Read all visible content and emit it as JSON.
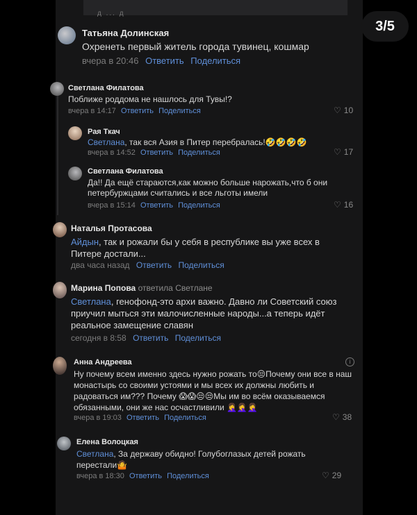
{
  "story": {
    "counter": "3/5",
    "top_strip_text": "д ... д"
  },
  "comments": {
    "c1": {
      "author": "Татьяна Долинская",
      "text": "Охренеть первый житель города тувинец, кошмар",
      "time": "вчера в 20:46",
      "reply": "Ответить",
      "share": "Поделиться"
    },
    "c2": {
      "author": "Светлана Филатова",
      "text": "Поближе роддома не нашлось для Тувы!?",
      "time": "вчера в 14:17",
      "reply": "Ответить",
      "share": "Поделиться",
      "likes": "10"
    },
    "c3": {
      "author": "Рая Ткач",
      "mention": "Светлана",
      "text": ", так вся Азия в Питер перебралась!🤣🤣🤣🤣",
      "time": "вчера в 14:52",
      "reply": "Ответить",
      "share": "Поделиться",
      "likes": "17"
    },
    "c4": {
      "author": "Светлана Филатова",
      "text": "Да!! Да ещё стараются,как можно больше нарожать,что б они петербуржцами считались и все льготы имели",
      "time": "вчера в 15:14",
      "reply": "Ответить",
      "share": "Поделиться",
      "likes": "16"
    },
    "c5": {
      "author": "Наталья Протасова",
      "mention": "Айдын",
      "text": ", так и рожали бы у себя в республике вы уже всех в Питере достали...",
      "time": "два часа назад",
      "reply": "Ответить",
      "share": "Поделиться"
    },
    "c6": {
      "author": "Марина Попова",
      "replied": "ответила Светлане",
      "mention": "Светлана",
      "text": ", генофонд-это архи важно. Давно ли Советский союз приучил мыться эти малочисленные народы...а теперь идёт реальное замещение славян",
      "time": "сегодня в 8:58",
      "reply": "Ответить",
      "share": "Поделиться"
    },
    "c7": {
      "author": "Анна Андреева",
      "text": "Ну почему всем именно здесь нужно рожать то😒Почему они все в наш монастырь со своими устоями и мы всех их должны любить и радоваться им??? Почему 😱😱😒😒Мы им во всём оказываемся обязанными, они же нас осчастливили 🤦‍♀️🤦‍♀️🤦‍♀️",
      "time": "вчера в 19:03",
      "reply": "Ответить",
      "share": "Поделиться",
      "likes": "38"
    },
    "c8": {
      "author": "Елена Волоцкая",
      "mention": "Светлана",
      "text": ", За державу обидно! Голубоглазых детей рожать перестали🤷",
      "time": "вчера в 18:30",
      "reply": "Ответить",
      "share": "Поделиться",
      "likes": "29"
    }
  },
  "colors": {
    "background": "#000000",
    "panel": "#161617",
    "link": "#5f8fd8",
    "text": "#d8d8d8",
    "muted": "#7c7c7c"
  }
}
